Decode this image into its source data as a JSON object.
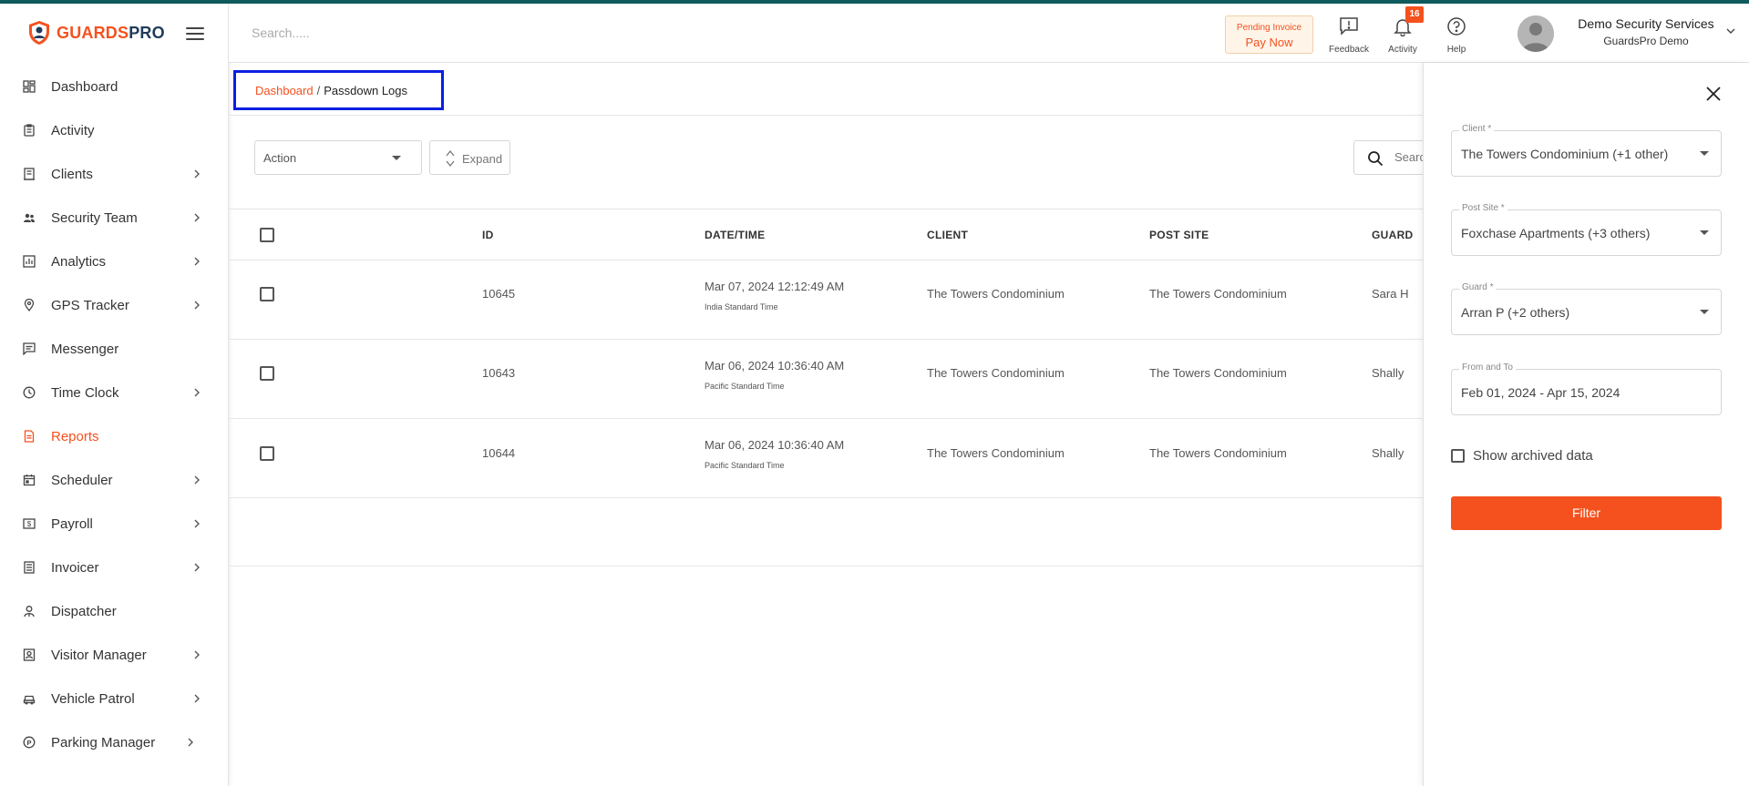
{
  "brand": {
    "name_a": "GUARDS",
    "name_b": "PRO"
  },
  "header": {
    "search_placeholder": "Search.....",
    "invoice": {
      "line1": "Pending Invoice",
      "line2": "Pay Now"
    },
    "actions": [
      {
        "label": "Feedback",
        "icon": "feedback-icon"
      },
      {
        "label": "Activity",
        "icon": "bell-icon",
        "badge": "16"
      },
      {
        "label": "Help",
        "icon": "help-icon"
      }
    ],
    "user": {
      "name": "Demo Security Services",
      "org": "GuardsPro Demo"
    }
  },
  "sidebar": {
    "items": [
      {
        "label": "Dashboard",
        "icon": "dashboard-icon",
        "chevron": false,
        "active": false
      },
      {
        "label": "Activity",
        "icon": "clipboard-icon",
        "chevron": false,
        "active": false
      },
      {
        "label": "Clients",
        "icon": "building-icon",
        "chevron": true,
        "active": false
      },
      {
        "label": "Security Team",
        "icon": "team-icon",
        "chevron": true,
        "active": false
      },
      {
        "label": "Analytics",
        "icon": "analytics-icon",
        "chevron": true,
        "active": false
      },
      {
        "label": "GPS Tracker",
        "icon": "location-pin-icon",
        "chevron": true,
        "active": false
      },
      {
        "label": "Messenger",
        "icon": "message-icon",
        "chevron": false,
        "active": false
      },
      {
        "label": "Time Clock",
        "icon": "clock-icon",
        "chevron": true,
        "active": false
      },
      {
        "label": "Reports",
        "icon": "report-icon",
        "chevron": false,
        "active": true
      },
      {
        "label": "Scheduler",
        "icon": "calendar-icon",
        "chevron": true,
        "active": false
      },
      {
        "label": "Payroll",
        "icon": "dollar-icon",
        "chevron": true,
        "active": false
      },
      {
        "label": "Invoicer",
        "icon": "invoice-icon",
        "chevron": true,
        "active": false
      },
      {
        "label": "Dispatcher",
        "icon": "dispatcher-icon",
        "chevron": false,
        "active": false
      },
      {
        "label": "Visitor Manager",
        "icon": "visitor-icon",
        "chevron": true,
        "active": false
      },
      {
        "label": "Vehicle Patrol",
        "icon": "car-icon",
        "chevron": true,
        "active": false
      },
      {
        "label": "Parking Manager",
        "icon": "parking-icon",
        "chevron": true,
        "active": false
      }
    ]
  },
  "breadcrumb": {
    "parent": "Dashboard",
    "separator": "/",
    "current": "Passdown Logs"
  },
  "toolbar": {
    "action_label": "Action",
    "expand_label": "Expand",
    "search_placeholder": "Search"
  },
  "table": {
    "columns": [
      "ID",
      "DATE/TIME",
      "CLIENT",
      "POST SITE",
      "GUARD"
    ],
    "rows": [
      {
        "id": "10645",
        "datetime": "Mar 07, 2024 12:12:49 AM",
        "tz": "India Standard Time",
        "client": "The Towers Condominium",
        "post_site": "The Towers Condominium",
        "guard": "Sara H"
      },
      {
        "id": "10643",
        "datetime": "Mar 06, 2024 10:36:40 AM",
        "tz": "Pacific Standard Time",
        "client": "The Towers Condominium",
        "post_site": "The Towers Condominium",
        "guard": "Shally"
      },
      {
        "id": "10644",
        "datetime": "Mar 06, 2024 10:36:40 AM",
        "tz": "Pacific Standard Time",
        "client": "The Towers Condominium",
        "post_site": "The Towers Condominium",
        "guard": "Shally"
      }
    ]
  },
  "filter_panel": {
    "client": {
      "label": "Client *",
      "value": "The Towers Condominium (+1 other)"
    },
    "post_site": {
      "label": "Post Site *",
      "value": "Foxchase Apartments (+3 others)"
    },
    "guard": {
      "label": "Guard *",
      "value": "Arran P (+2 others)"
    },
    "date_range": {
      "label": "From and To",
      "value": "Feb 01, 2024 - Apr 15, 2024"
    },
    "archived_label": "Show archived data",
    "filter_button": "Filter"
  },
  "colors": {
    "accent": "#f4511e",
    "brand_dark": "#1f3b5a",
    "highlight_border": "#0a1fe0"
  }
}
